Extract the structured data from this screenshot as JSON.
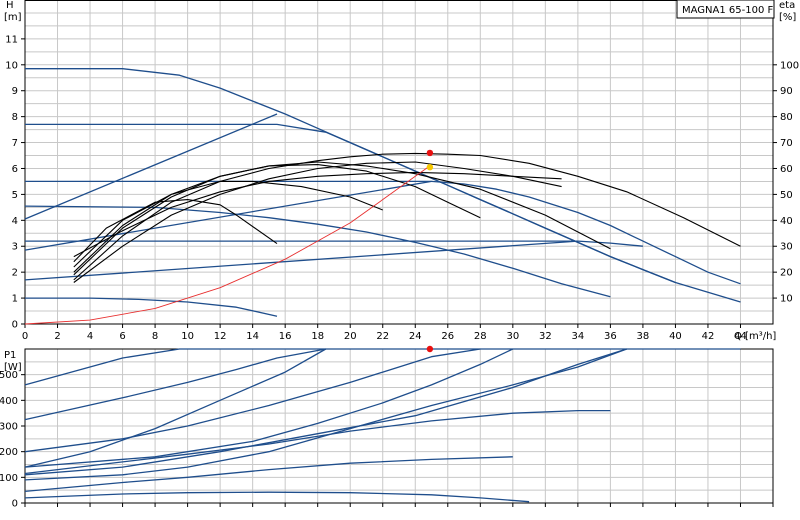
{
  "chart_data": [
    {
      "type": "line",
      "title": "MAGNA1 65-100 F",
      "xlabel": "Q [m³/h]",
      "ylabel": "H [m]",
      "ylabel_right": "eta [%]",
      "ylabel_lines": [
        "H",
        "[m]"
      ],
      "ylabel_right_lines": [
        "eta",
        "[%]"
      ],
      "xlim": [
        0,
        46
      ],
      "ylim": [
        0,
        12.5
      ],
      "ylim_right": [
        0,
        125
      ],
      "xticks": [
        0,
        2,
        4,
        6,
        8,
        10,
        12,
        14,
        16,
        18,
        20,
        22,
        24,
        26,
        28,
        30,
        32,
        34,
        36,
        38,
        40,
        42,
        44
      ],
      "yticks": [
        0,
        1,
        2,
        3,
        4,
        5,
        6,
        7,
        8,
        9,
        10,
        11
      ],
      "yticks_right": [
        10,
        20,
        30,
        40,
        50,
        60,
        70,
        80,
        90,
        100
      ],
      "grid": true,
      "colors": {
        "head": "#1f4e8c",
        "eta": "#000000",
        "system": "#e83030",
        "dutyRed": "#e81010",
        "dutyYellow": "#f6c800"
      },
      "series": [
        {
          "kind": "head",
          "points": [
            [
              0,
              9.85
            ],
            [
              6,
              9.85
            ],
            [
              9.5,
              9.6
            ],
            [
              12,
              9.1
            ],
            [
              14,
              8.6
            ],
            [
              16,
              8.1
            ],
            [
              18,
              7.55
            ],
            [
              20,
              7.0
            ],
            [
              22,
              6.45
            ],
            [
              24,
              5.9
            ],
            [
              26,
              5.35
            ],
            [
              28,
              4.8
            ],
            [
              30,
              4.25
            ],
            [
              32,
              3.7
            ],
            [
              34,
              3.15
            ],
            [
              36,
              2.6
            ],
            [
              38,
              2.1
            ],
            [
              40,
              1.6
            ]
          ]
        },
        {
          "kind": "head",
          "points": [
            [
              0,
              7.7
            ],
            [
              15.5,
              7.7
            ],
            [
              18.5,
              7.4
            ],
            [
              20,
              7.0
            ],
            [
              22,
              6.45
            ],
            [
              24,
              5.9
            ],
            [
              26,
              5.35
            ],
            [
              28,
              4.8
            ],
            [
              30,
              4.25
            ],
            [
              32,
              3.7
            ],
            [
              34,
              3.15
            ],
            [
              36,
              2.6
            ],
            [
              38,
              2.1
            ],
            [
              40,
              1.6
            ],
            [
              44,
              0.85
            ]
          ]
        },
        {
          "kind": "head",
          "points": [
            [
              0,
              5.5
            ],
            [
              25,
              5.5
            ],
            [
              27,
              5.4
            ],
            [
              29,
              5.2
            ],
            [
              31,
              4.9
            ],
            [
              34,
              4.3
            ],
            [
              36,
              3.8
            ],
            [
              38,
              3.2
            ],
            [
              40,
              2.6
            ],
            [
              42,
              2.0
            ],
            [
              44,
              1.55
            ]
          ]
        },
        {
          "kind": "head",
          "points": [
            [
              0,
              4.55
            ],
            [
              8,
              4.5
            ],
            [
              12,
              4.3
            ],
            [
              15,
              4.1
            ],
            [
              18,
              3.85
            ],
            [
              21,
              3.55
            ],
            [
              24,
              3.15
            ],
            [
              27,
              2.7
            ],
            [
              30,
              2.15
            ],
            [
              33,
              1.55
            ],
            [
              36,
              1.05
            ]
          ]
        },
        {
          "kind": "head",
          "points": [
            [
              0,
              3.2
            ],
            [
              34,
              3.2
            ],
            [
              36,
              3.12
            ],
            [
              38,
              3.0
            ]
          ]
        },
        {
          "kind": "head",
          "points": [
            [
              0,
              1.0
            ],
            [
              4,
              1.0
            ],
            [
              7,
              0.95
            ],
            [
              10,
              0.85
            ],
            [
              13,
              0.65
            ],
            [
              15.5,
              0.3
            ]
          ]
        },
        {
          "kind": "head",
          "points": [
            [
              0,
              4.05
            ],
            [
              15.5,
              8.1
            ]
          ]
        },
        {
          "kind": "head",
          "points": [
            [
              0,
              2.85
            ],
            [
              25,
              5.5
            ]
          ]
        },
        {
          "kind": "head",
          "points": [
            [
              0,
              1.7
            ],
            [
              34,
              3.2
            ]
          ]
        },
        {
          "kind": "eta",
          "points": [
            [
              3,
              17
            ],
            [
              6,
              34
            ],
            [
              9,
              47
            ],
            [
              12,
              55
            ],
            [
              15,
              60
            ],
            [
              18,
              63
            ],
            [
              20,
              64.5
            ],
            [
              22,
              65.5
            ],
            [
              24,
              65.8
            ],
            [
              26,
              65.5
            ],
            [
              28,
              65
            ],
            [
              31,
              62
            ],
            [
              34,
              57
            ],
            [
              37,
              51
            ],
            [
              40.5,
              41
            ],
            [
              44,
              30
            ]
          ]
        },
        {
          "kind": "eta",
          "points": [
            [
              3,
              19
            ],
            [
              6,
              37
            ],
            [
              9,
              49
            ],
            [
              12,
              57
            ],
            [
              15,
              61
            ],
            [
              18,
              62.5
            ],
            [
              21,
              61
            ],
            [
              24,
              58
            ],
            [
              28,
              52
            ],
            [
              32,
              42
            ],
            [
              36,
              29
            ]
          ]
        },
        {
          "kind": "eta",
          "points": [
            [
              3,
              20
            ],
            [
              6,
              38
            ],
            [
              9,
              50
            ],
            [
              12,
              57
            ],
            [
              15,
              61
            ],
            [
              18,
              61.5
            ],
            [
              21,
              59
            ],
            [
              24,
              53
            ],
            [
              26,
              47
            ],
            [
              28,
              41
            ]
          ]
        },
        {
          "kind": "eta",
          "points": [
            [
              3,
              22
            ],
            [
              6,
              40
            ],
            [
              9,
              50
            ],
            [
              12,
              55
            ],
            [
              14,
              55
            ],
            [
              17,
              53
            ],
            [
              20,
              49
            ],
            [
              22,
              44
            ]
          ]
        },
        {
          "kind": "eta",
          "points": [
            [
              3,
              24
            ],
            [
              5,
              37
            ],
            [
              8,
              47
            ],
            [
              10,
              48
            ],
            [
              12,
              46
            ],
            [
              13,
              42
            ],
            [
              15.5,
              31
            ]
          ]
        },
        {
          "kind": "eta",
          "points": [
            [
              3,
              26
            ],
            [
              6,
              36
            ],
            [
              9,
              45
            ],
            [
              12,
              51
            ],
            [
              15,
              55
            ],
            [
              18,
              57
            ],
            [
              21,
              58
            ],
            [
              24,
              58.5
            ],
            [
              27,
              58
            ],
            [
              30,
              57
            ],
            [
              33,
              56
            ]
          ]
        },
        {
          "kind": "eta",
          "points": [
            [
              3,
              16
            ],
            [
              6,
              30
            ],
            [
              9,
              42
            ],
            [
              12,
              50
            ],
            [
              15,
              56
            ],
            [
              18,
              60
            ],
            [
              21,
              62
            ],
            [
              24,
              62.5
            ],
            [
              27,
              60
            ],
            [
              30,
              57
            ],
            [
              33,
              53
            ]
          ]
        },
        {
          "kind": "system",
          "points": [
            [
              0,
              0
            ],
            [
              4,
              0.15
            ],
            [
              8,
              0.6
            ],
            [
              12,
              1.4
            ],
            [
              16,
              2.5
            ],
            [
              20,
              3.9
            ],
            [
              24,
              5.7
            ],
            [
              24.9,
              6.1
            ]
          ]
        }
      ],
      "points": [
        {
          "kind": "dutyRed",
          "x": 24.9,
          "y": 6.6
        },
        {
          "kind": "dutyYellow",
          "x": 24.9,
          "y": 6.05
        }
      ]
    },
    {
      "type": "line",
      "xlabel": "",
      "ylabel": "P1 [W]",
      "ylabel_lines": [
        "P1",
        "[W]"
      ],
      "xlim": [
        0,
        46
      ],
      "ylim": [
        0,
        600
      ],
      "yticks": [
        0,
        100,
        200,
        300,
        400,
        500
      ],
      "grid": true,
      "series": [
        {
          "kind": "power",
          "points": [
            [
              0,
              460
            ],
            [
              6,
              565
            ],
            [
              9.5,
              600
            ],
            [
              15.5,
              600
            ],
            [
              44,
              600
            ]
          ]
        },
        {
          "kind": "power",
          "points": [
            [
              0,
              325
            ],
            [
              6,
              410
            ],
            [
              10,
              470
            ],
            [
              13,
              520
            ],
            [
              15.5,
              565
            ],
            [
              18.5,
              600
            ]
          ]
        },
        {
          "kind": "power",
          "points": [
            [
              0,
              140
            ],
            [
              4,
              200
            ],
            [
              8,
              290
            ],
            [
              12,
              400
            ],
            [
              16,
              510
            ],
            [
              18.5,
              600
            ]
          ]
        },
        {
          "kind": "power",
          "points": [
            [
              0,
              200
            ],
            [
              6,
              250
            ],
            [
              10,
              300
            ],
            [
              15,
              380
            ],
            [
              20,
              470
            ],
            [
              25,
              570
            ],
            [
              28,
              600
            ]
          ]
        },
        {
          "kind": "power",
          "points": [
            [
              0,
              140
            ],
            [
              8,
              180
            ],
            [
              14,
              240
            ],
            [
              18,
              310
            ],
            [
              22,
              390
            ],
            [
              25,
              460
            ],
            [
              28,
              540
            ],
            [
              30,
              600
            ]
          ]
        },
        {
          "kind": "power",
          "points": [
            [
              0,
              110
            ],
            [
              6,
              140
            ],
            [
              12,
              200
            ],
            [
              18,
              270
            ],
            [
              24,
              340
            ],
            [
              30,
              450
            ],
            [
              34,
              540
            ],
            [
              37,
              600
            ]
          ]
        },
        {
          "kind": "power",
          "points": [
            [
              0,
              90
            ],
            [
              6,
              110
            ],
            [
              10,
              140
            ],
            [
              15,
              200
            ],
            [
              20,
              290
            ],
            [
              25,
              380
            ],
            [
              30,
              460
            ],
            [
              34,
              530
            ],
            [
              37,
              600
            ]
          ]
        },
        {
          "kind": "power",
          "points": [
            [
              0,
              115
            ],
            [
              10,
              190
            ],
            [
              15,
              230
            ],
            [
              20,
              280
            ],
            [
              25,
              320
            ],
            [
              30,
              350
            ],
            [
              34,
              360
            ],
            [
              36,
              360
            ]
          ]
        },
        {
          "kind": "power",
          "points": [
            [
              0,
              45
            ],
            [
              6,
              80
            ],
            [
              10,
              100
            ],
            [
              15,
              130
            ],
            [
              20,
              155
            ],
            [
              25,
              170
            ],
            [
              30,
              180
            ]
          ]
        },
        {
          "kind": "power",
          "points": [
            [
              0,
              20
            ],
            [
              6,
              35
            ],
            [
              10,
              40
            ],
            [
              15,
              42
            ],
            [
              20,
              40
            ],
            [
              25,
              32
            ],
            [
              28,
              20
            ],
            [
              31,
              5
            ]
          ]
        }
      ],
      "points": [
        {
          "kind": "dutyRed",
          "x": 24.9,
          "y": 600
        }
      ]
    }
  ]
}
